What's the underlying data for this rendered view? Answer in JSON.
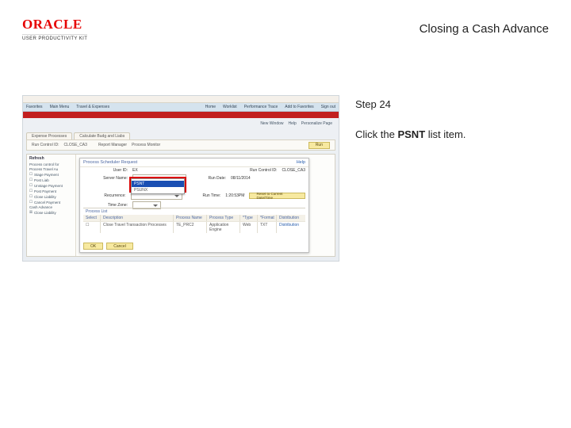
{
  "brand": {
    "name": "ORACLE",
    "product": "USER PRODUCTIVITY KIT"
  },
  "title": "Closing a Cash Advance",
  "step": "Step 24",
  "instruction_prefix": "Click the ",
  "instruction_bold": "PSNT",
  "instruction_suffix": " list item.",
  "shot": {
    "menu": {
      "items": [
        "Favorites",
        "Main Menu",
        "",
        "Travel & Expenses",
        "",
        "Home",
        "",
        "Worklist",
        "",
        "Performance Trace",
        "",
        "Add to Favorites",
        "",
        "Sign out"
      ]
    },
    "subheader": [
      "New Window",
      "Help",
      "Personalize Page"
    ],
    "tabs": [
      "Expense Processes",
      "Calculate Budg and Liabs"
    ],
    "bar": {
      "run_label": "Run Control ID:",
      "run_value": "CLOSE_CA3",
      "report_label": "Report Manager",
      "monitor_label": "Process Monitor",
      "run_btn": "Run"
    },
    "sidebar": {
      "hdr": "Refresh",
      "items": [
        "Process control for",
        "Process Travel Au",
        "",
        "Stage Payment",
        "Post Liab",
        "Unstage Payment",
        "Post Payment",
        "Close Liability",
        "Cancel Payment",
        "Cash Advance",
        "Close Liability"
      ]
    },
    "modal": {
      "title": "Process Scheduler Request",
      "help": "Help",
      "userid_lbl": "User ID:",
      "userid_val": "EX",
      "runctl_lbl": "Run Control ID:",
      "runctl_val": "CLOSE_CA3",
      "server_lbl": "Server Name:",
      "rundate_lbl": "Run Date:",
      "rundate_val": "08/11/2014",
      "recur_lbl": "Recurrence:",
      "runtime_lbl": "Run Time:",
      "runtime_val": "1:20:53PM",
      "reset_btn": "Reset to Current Date/Time",
      "tz_lbl": "Time Zone:",
      "proclist_lbl": "Process List",
      "dropdown_options": [
        "",
        "PSNT",
        "PSUNX"
      ],
      "dropdown_selected": "PSNT",
      "grid": {
        "headers": [
          "Select",
          "Description",
          "Process Name",
          "Process Type",
          "*Type",
          "*Format",
          "Distribution"
        ],
        "row": [
          "☐",
          "Close Travel Transaction Processes",
          "TE_PRC2",
          "Application Engine",
          "Web",
          "TXT",
          "Distribution"
        ]
      },
      "btn_ok": "OK",
      "btn_cancel": "Cancel"
    }
  }
}
